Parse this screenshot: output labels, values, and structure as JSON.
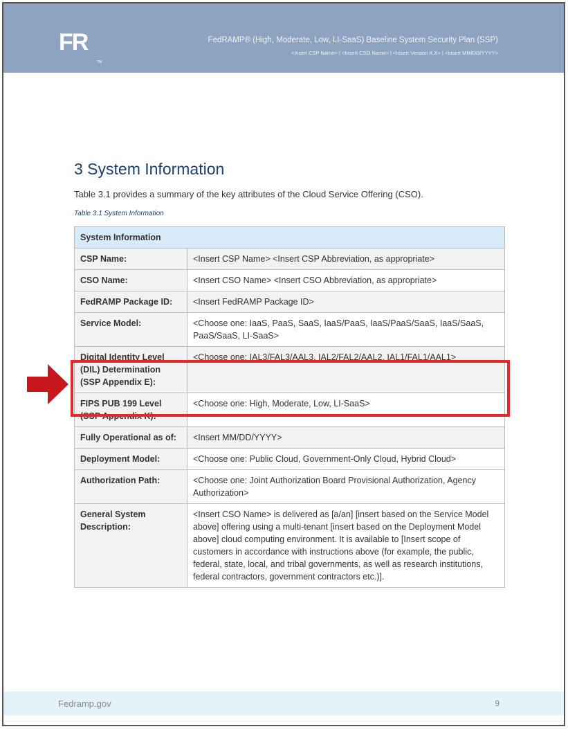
{
  "header": {
    "logo_text": "FR",
    "logo_tm": "TM",
    "title": "FedRAMP® (High, Moderate, Low, LI-SaaS) Baseline System Security Plan (SSP)",
    "subtitle": "<Insert CSP Name> | <Insert CSO Name> | <Insert Version X.X> | <Insert MM/DD/YYYY>"
  },
  "section": {
    "title": "3  System Information",
    "intro": "Table 3.1 provides a summary of the key attributes of the Cloud Service Offering (CSO).",
    "caption": "Table 3.1 System Information"
  },
  "table": {
    "header": "System Information",
    "rows": [
      {
        "label": "CSP Name:",
        "value": "<Insert CSP Name> <Insert CSP Abbreviation, as appropriate>"
      },
      {
        "label": "CSO Name:",
        "value": "<Insert CSO Name> <Insert CSO Abbreviation, as appropriate>"
      },
      {
        "label": "FedRAMP Package ID:",
        "value": "<Insert FedRAMP Package ID>"
      },
      {
        "label": "Service Model:",
        "value": "<Choose one: IaaS, PaaS, SaaS, IaaS/PaaS, IaaS/PaaS/SaaS, IaaS/SaaS, PaaS/SaaS, LI-SaaS>"
      },
      {
        "label": "Digital Identity Level (DIL) Determination (SSP Appendix E):",
        "value": "<Choose one: IAL3/FAL3/AAL3, IAL2/FAL2/AAL2, IAL1/FAL1/AAL1>"
      },
      {
        "label": "FIPS PUB 199 Level (SSP Appendix K):",
        "value": "<Choose one: High, Moderate, Low, LI-SaaS>"
      },
      {
        "label": "Fully Operational as of:",
        "value": "<Insert MM/DD/YYYY>"
      },
      {
        "label": "Deployment Model:",
        "value": "<Choose one: Public Cloud, Government-Only Cloud, Hybrid Cloud>"
      },
      {
        "label": "Authorization Path:",
        "value": "<Choose one: Joint Authorization Board Provisional Authorization, Agency Authorization>"
      },
      {
        "label": "General System Description:",
        "value": "<Insert CSO Name> is delivered as [a/an] [insert based on the Service Model above] offering using a multi-tenant [insert based on the Deployment Model above] cloud computing environment. It is available to [Insert scope of customers in accordance with instructions above (for example, the public, federal, state, local, and tribal governments, as well as research institutions, federal contractors, government contractors etc.)]."
      }
    ]
  },
  "annotation": {
    "arrow_color": "#c8171c",
    "box_color": "#e8262b"
  },
  "footer": {
    "site": "Fedramp.gov",
    "page_number": "9"
  }
}
